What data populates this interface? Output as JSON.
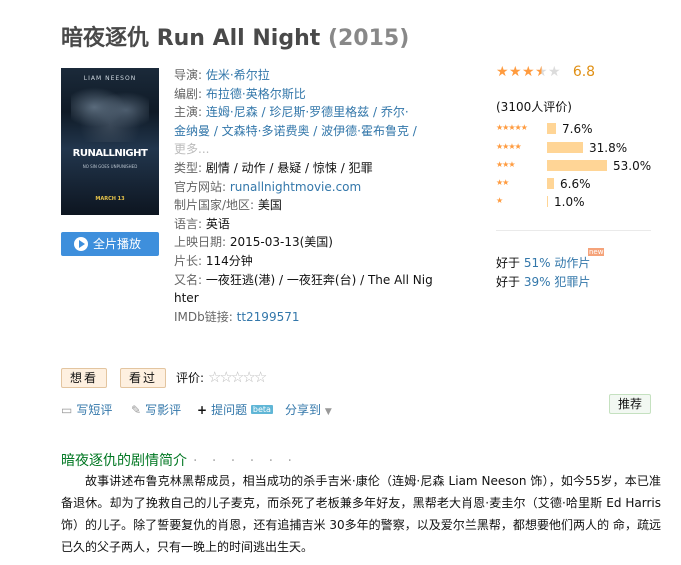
{
  "movie": {
    "title_cn": "暗夜逐仇",
    "title_en": "Run All Night",
    "year": "(2015)"
  },
  "poster": {
    "actor": "LIAM NEESON",
    "title": "RUNALLNIGHT",
    "tagline": "NO SIN GOES UNPUNISHED",
    "date": "MARCH 13"
  },
  "play_button": {
    "label": "全片播放",
    "icon": "play-icon"
  },
  "info": {
    "director_label": "导演:",
    "director": "佐米·希尔拉",
    "writer_label": "编剧:",
    "writer": "布拉德·英格尔斯比",
    "cast_label": "主演:",
    "cast_line1": "连姆·尼森 / 珍尼斯·罗德里格兹 / 乔尔·",
    "cast_line2": "金纳曼 / 文森特·多诺费奥 / 波伊德·霍布鲁克 /",
    "cast_more": "更多...",
    "genre_label": "类型:",
    "genre": "剧情 / 动作 / 悬疑 / 惊悚 / 犯罪",
    "website_label": "官方网站:",
    "website": "runallnightmovie.com",
    "country_label": "制片国家/地区:",
    "country": "美国",
    "language_label": "语言:",
    "language": "英语",
    "release_label": "上映日期:",
    "release": "2015-03-13(美国)",
    "runtime_label": "片长:",
    "runtime": "114分钟",
    "aka_label": "又名:",
    "aka_line1": "一夜狂逃(港) / 一夜狂奔(台) / The All Nig",
    "aka_line2": "hter",
    "imdb_label": "IMDb链接:",
    "imdb": "tt2199571"
  },
  "rating": {
    "score": "6.8",
    "stars_value": 3.5,
    "votes": "(3100人评价)",
    "distribution": [
      {
        "stars": "★★★★★",
        "percent": "7.6%",
        "value": 7.6
      },
      {
        "stars": "★★★★",
        "percent": "31.8%",
        "value": 31.8
      },
      {
        "stars": "★★★",
        "percent": "53.0%",
        "value": 53.0
      },
      {
        "stars": "★★",
        "percent": "6.6%",
        "value": 6.6
      },
      {
        "stars": "★",
        "percent": "1.0%",
        "value": 1.0
      }
    ],
    "better_than": [
      {
        "prefix": "好于",
        "percent": "51%",
        "genre": "动作片",
        "badge": "new"
      },
      {
        "prefix": "好于",
        "percent": "39%",
        "genre": "犯罪片"
      }
    ],
    "star_color": "#ff9b3f",
    "bar_color": "#ffd596"
  },
  "interest": {
    "want_label": "想看",
    "seen_label": "看过",
    "rate_label": "评价:"
  },
  "actions": {
    "write_short": "写短评",
    "write_review": "写影评",
    "ask": "提问题",
    "beta": "beta",
    "share": "分享到",
    "recommend": "推荐"
  },
  "synopsis": {
    "heading": "暗夜逐仇的剧情简介",
    "dots": "· · · · · ·",
    "text": "故事讲述布鲁克林黑帮成员，相当成功的杀手吉米·康伦（连姆·尼森 Liam Neeson 饰），如今55岁，本已准备退休。却为了挽救自己的儿子麦克，而杀死了老板兼多年好友，黑帮老大肖恩·麦圭尔（艾德·哈里斯 Ed Harris 饰）的儿子。除了誓要复仇的肖恩，还有追捕吉米 30多年的警察，以及爱尔兰黑帮，都想要他们两人的 命，疏远已久的父子两人，只有一晚上的时间逃出生天。"
  }
}
